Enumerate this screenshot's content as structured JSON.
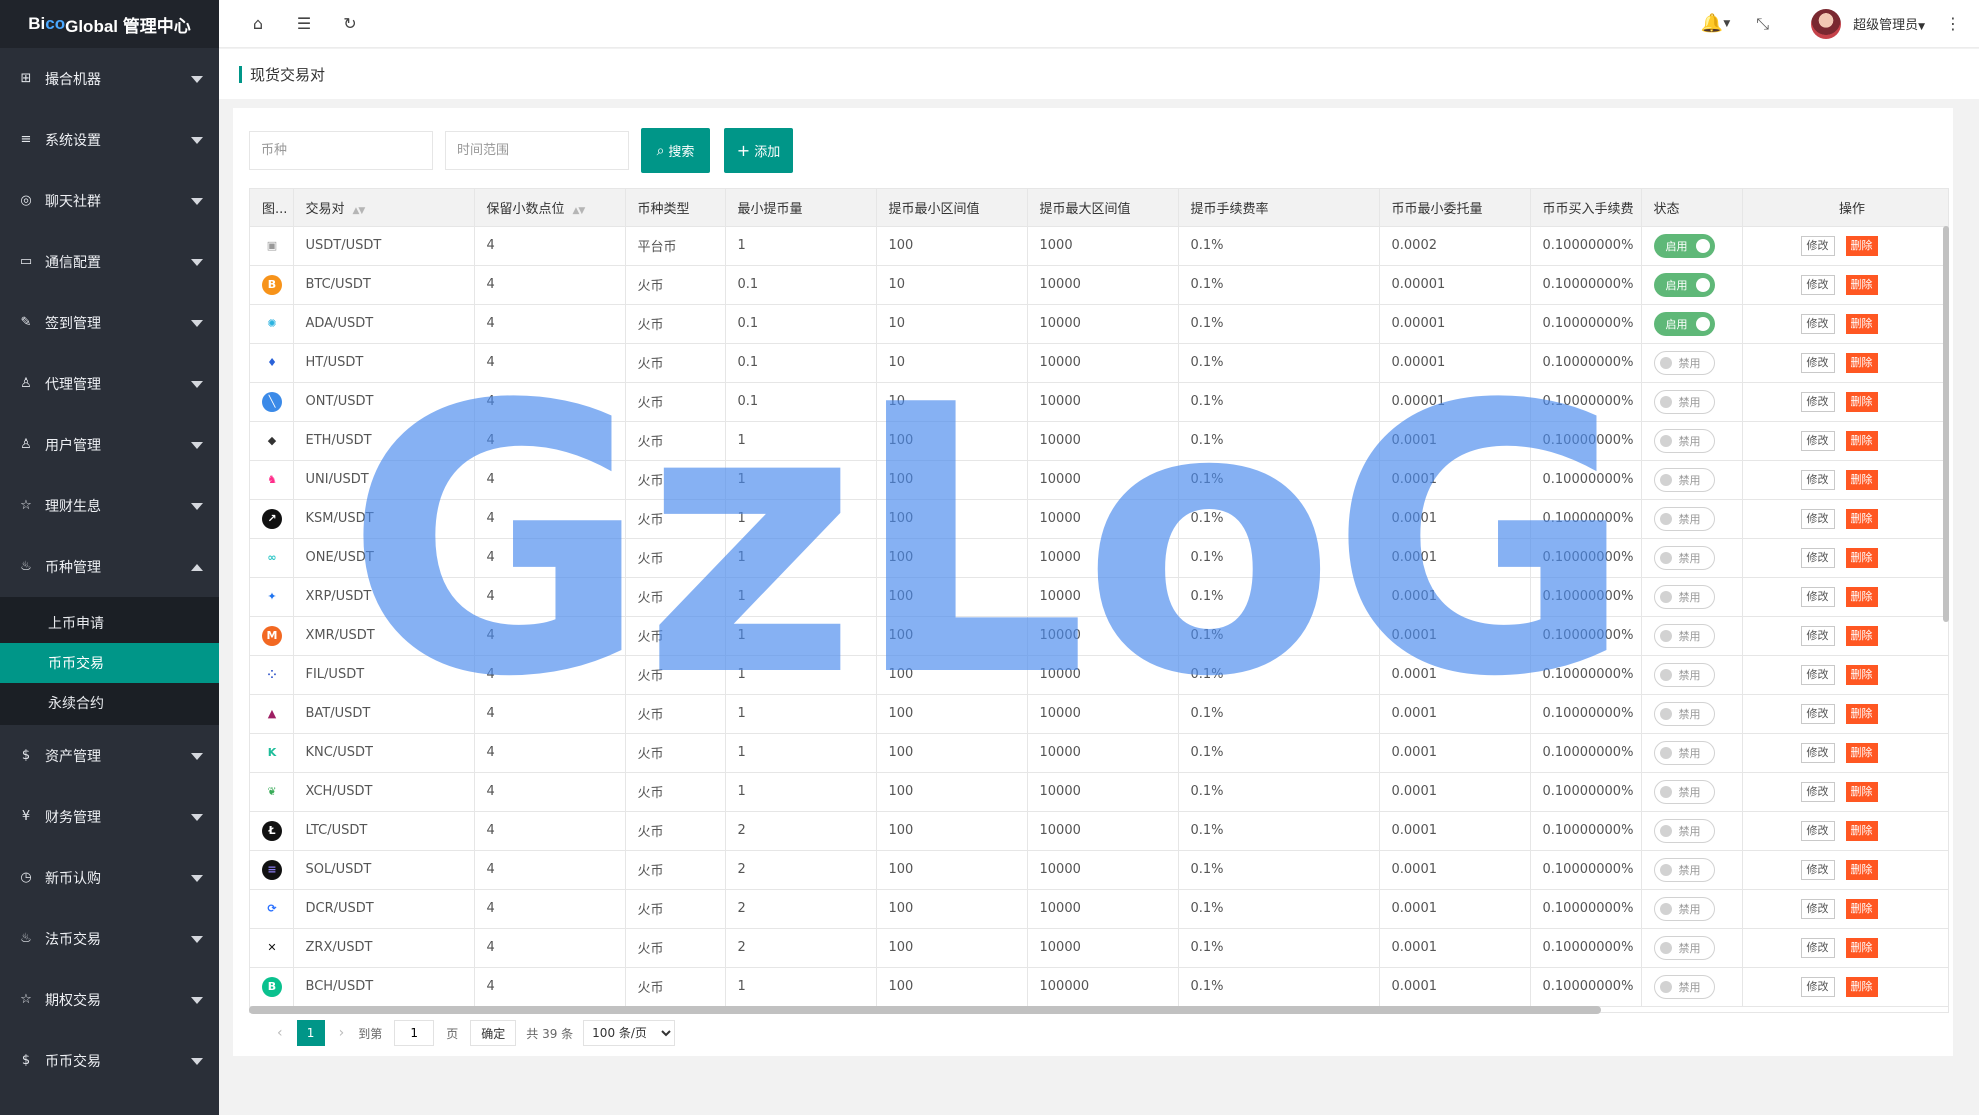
{
  "app": {
    "logo_part1": "Bi",
    "logo_accent": "co",
    "logo_part2": " Global 管理中心"
  },
  "sidebar": {
    "items_top": [
      {
        "label": "撮合机器",
        "icon": "grid-icon",
        "glyph": "⊞"
      },
      {
        "label": "系统设置",
        "icon": "sliders-icon",
        "glyph": "≡"
      },
      {
        "label": "聊天社群",
        "icon": "chat-icon",
        "glyph": "◎"
      },
      {
        "label": "通信配置",
        "icon": "device-icon",
        "glyph": "▭"
      },
      {
        "label": "签到管理",
        "icon": "edit-icon",
        "glyph": "✎"
      },
      {
        "label": "代理管理",
        "icon": "user-icon",
        "glyph": "♙"
      },
      {
        "label": "用户管理",
        "icon": "users-icon",
        "glyph": "♙"
      },
      {
        "label": "理财生息",
        "icon": "star-icon",
        "glyph": "☆"
      },
      {
        "label": "币种管理",
        "icon": "fire-icon",
        "glyph": "♨"
      }
    ],
    "submenu": [
      "上币申请",
      "币币交易",
      "永续合约"
    ],
    "items_bottom": [
      {
        "label": "资产管理",
        "icon": "dollar-icon",
        "glyph": "$"
      },
      {
        "label": "财务管理",
        "icon": "yen-icon",
        "glyph": "¥"
      },
      {
        "label": "新币认购",
        "icon": "clock-icon",
        "glyph": "◷"
      },
      {
        "label": "法币交易",
        "icon": "fire-icon",
        "glyph": "♨"
      },
      {
        "label": "期权交易",
        "icon": "star-icon",
        "glyph": "☆"
      },
      {
        "label": "币币交易",
        "icon": "dollar-icon",
        "glyph": "$"
      }
    ]
  },
  "header": {
    "user_name": "超级管理员"
  },
  "page": {
    "title": "现货交易对"
  },
  "search": {
    "coin_placeholder": "币种",
    "time_placeholder": "时间范围",
    "search_label": "搜索",
    "add_label": "添加"
  },
  "table": {
    "headers": [
      "图...",
      "交易对",
      "保留小数点位",
      "币种类型",
      "最小提币量",
      "提币最小区间值",
      "提币最大区间值",
      "提币手续费率",
      "币币最小委托量",
      "币币买入手续费",
      "状态",
      "操作"
    ],
    "edit_label": "修改",
    "delete_label": "删除",
    "on_label": "启用",
    "off_label": "禁用",
    "rows": [
      {
        "pair": "USDT/USDT",
        "decimals": "4",
        "type": "平台币",
        "min_w": "1",
        "w_min": "100",
        "w_max": "1000",
        "fee": "0.1%",
        "min_order": "0.0002",
        "buy_fee": "0.10000000%",
        "enabled": true,
        "icon_bg": "#ffffff",
        "icon_fg": "#999999",
        "glyph": "▣"
      },
      {
        "pair": "BTC/USDT",
        "decimals": "4",
        "type": "火币",
        "min_w": "0.1",
        "w_min": "10",
        "w_max": "10000",
        "fee": "0.1%",
        "min_order": "0.00001",
        "buy_fee": "0.10000000%",
        "enabled": true,
        "icon_bg": "#f7931a",
        "icon_fg": "#ffffff",
        "glyph": "B"
      },
      {
        "pair": "ADA/USDT",
        "decimals": "4",
        "type": "火币",
        "min_w": "0.1",
        "w_min": "10",
        "w_max": "10000",
        "fee": "0.1%",
        "min_order": "0.00001",
        "buy_fee": "0.10000000%",
        "enabled": true,
        "icon_bg": "#ffffff",
        "icon_fg": "#2bb3e0",
        "glyph": "✺"
      },
      {
        "pair": "HT/USDT",
        "decimals": "4",
        "type": "火币",
        "min_w": "0.1",
        "w_min": "10",
        "w_max": "10000",
        "fee": "0.1%",
        "min_order": "0.00001",
        "buy_fee": "0.10000000%",
        "enabled": false,
        "icon_bg": "#ffffff",
        "icon_fg": "#2a62d8",
        "glyph": "♦"
      },
      {
        "pair": "ONT/USDT",
        "decimals": "4",
        "type": "火币",
        "min_w": "0.1",
        "w_min": "10",
        "w_max": "10000",
        "fee": "0.1%",
        "min_order": "0.00001",
        "buy_fee": "0.10000000%",
        "enabled": false,
        "icon_bg": "#3b8ae8",
        "icon_fg": "#ffffff",
        "glyph": "╲"
      },
      {
        "pair": "ETH/USDT",
        "decimals": "4",
        "type": "火币",
        "min_w": "1",
        "w_min": "100",
        "w_max": "10000",
        "fee": "0.1%",
        "min_order": "0.0001",
        "buy_fee": "0.10000000%",
        "enabled": false,
        "icon_bg": "#ffffff",
        "icon_fg": "#333333",
        "glyph": "◆"
      },
      {
        "pair": "UNI/USDT",
        "decimals": "4",
        "type": "火币",
        "min_w": "1",
        "w_min": "100",
        "w_max": "10000",
        "fee": "0.1%",
        "min_order": "0.0001",
        "buy_fee": "0.10000000%",
        "enabled": false,
        "icon_bg": "#ffffff",
        "icon_fg": "#ff2d8a",
        "glyph": "♞"
      },
      {
        "pair": "KSM/USDT",
        "decimals": "4",
        "type": "火币",
        "min_w": "1",
        "w_min": "100",
        "w_max": "10000",
        "fee": "0.1%",
        "min_order": "0.0001",
        "buy_fee": "0.10000000%",
        "enabled": false,
        "icon_bg": "#111111",
        "icon_fg": "#ffffff",
        "glyph": "↗"
      },
      {
        "pair": "ONE/USDT",
        "decimals": "4",
        "type": "火币",
        "min_w": "1",
        "w_min": "100",
        "w_max": "10000",
        "fee": "0.1%",
        "min_order": "0.0001",
        "buy_fee": "0.10000000%",
        "enabled": false,
        "icon_bg": "#ffffff",
        "icon_fg": "#2bc6c6",
        "glyph": "∞"
      },
      {
        "pair": "XRP/USDT",
        "decimals": "4",
        "type": "火币",
        "min_w": "1",
        "w_min": "100",
        "w_max": "10000",
        "fee": "0.1%",
        "min_order": "0.0001",
        "buy_fee": "0.10000000%",
        "enabled": false,
        "icon_bg": "#ffffff",
        "icon_fg": "#1e73f0",
        "glyph": "✦"
      },
      {
        "pair": "XMR/USDT",
        "decimals": "4",
        "type": "火币",
        "min_w": "1",
        "w_min": "100",
        "w_max": "10000",
        "fee": "0.1%",
        "min_order": "0.0001",
        "buy_fee": "0.10000000%",
        "enabled": false,
        "icon_bg": "#f26822",
        "icon_fg": "#ffffff",
        "glyph": "M"
      },
      {
        "pair": "FIL/USDT",
        "decimals": "4",
        "type": "火币",
        "min_w": "1",
        "w_min": "100",
        "w_max": "10000",
        "fee": "0.1%",
        "min_order": "0.0001",
        "buy_fee": "0.10000000%",
        "enabled": false,
        "icon_bg": "#ffffff",
        "icon_fg": "#2b50c8",
        "glyph": "⁘"
      },
      {
        "pair": "BAT/USDT",
        "decimals": "4",
        "type": "火币",
        "min_w": "1",
        "w_min": "100",
        "w_max": "10000",
        "fee": "0.1%",
        "min_order": "0.0001",
        "buy_fee": "0.10000000%",
        "enabled": false,
        "icon_bg": "#ffffff",
        "icon_fg": "#9e1f63",
        "glyph": "▲"
      },
      {
        "pair": "KNC/USDT",
        "decimals": "4",
        "type": "火币",
        "min_w": "1",
        "w_min": "100",
        "w_max": "10000",
        "fee": "0.1%",
        "min_order": "0.0001",
        "buy_fee": "0.10000000%",
        "enabled": false,
        "icon_bg": "#ffffff",
        "icon_fg": "#1ebd9a",
        "glyph": "K"
      },
      {
        "pair": "XCH/USDT",
        "decimals": "4",
        "type": "火币",
        "min_w": "1",
        "w_min": "100",
        "w_max": "10000",
        "fee": "0.1%",
        "min_order": "0.0001",
        "buy_fee": "0.10000000%",
        "enabled": false,
        "icon_bg": "#ffffff",
        "icon_fg": "#3aac59",
        "glyph": "❦"
      },
      {
        "pair": "LTC/USDT",
        "decimals": "4",
        "type": "火币",
        "min_w": "2",
        "w_min": "100",
        "w_max": "10000",
        "fee": "0.1%",
        "min_order": "0.0001",
        "buy_fee": "0.10000000%",
        "enabled": false,
        "icon_bg": "#111111",
        "icon_fg": "#ffffff",
        "glyph": "Ł"
      },
      {
        "pair": "SOL/USDT",
        "decimals": "4",
        "type": "火币",
        "min_w": "2",
        "w_min": "100",
        "w_max": "10000",
        "fee": "0.1%",
        "min_order": "0.0001",
        "buy_fee": "0.10000000%",
        "enabled": false,
        "icon_bg": "#111111",
        "icon_fg": "#8a7cf0",
        "glyph": "≡"
      },
      {
        "pair": "DCR/USDT",
        "decimals": "4",
        "type": "火币",
        "min_w": "2",
        "w_min": "100",
        "w_max": "10000",
        "fee": "0.1%",
        "min_order": "0.0001",
        "buy_fee": "0.10000000%",
        "enabled": false,
        "icon_bg": "#ffffff",
        "icon_fg": "#2970ff",
        "glyph": "⟳"
      },
      {
        "pair": "ZRX/USDT",
        "decimals": "4",
        "type": "火币",
        "min_w": "2",
        "w_min": "100",
        "w_max": "10000",
        "fee": "0.1%",
        "min_order": "0.0001",
        "buy_fee": "0.10000000%",
        "enabled": false,
        "icon_bg": "#ffffff",
        "icon_fg": "#111111",
        "glyph": "✕"
      },
      {
        "pair": "BCH/USDT",
        "decimals": "4",
        "type": "火币",
        "min_w": "1",
        "w_min": "100",
        "w_max": "100000",
        "fee": "0.1%",
        "min_order": "0.0001",
        "buy_fee": "0.10000000%",
        "enabled": false,
        "icon_bg": "#0ac18e",
        "icon_fg": "#ffffff",
        "glyph": "B"
      }
    ]
  },
  "pager": {
    "current_page": "1",
    "goto_label": "到第",
    "page_input": "1",
    "page_unit": "页",
    "confirm_label": "确定",
    "total_label": "共 39 条",
    "page_size_options": [
      "100 条/页"
    ]
  },
  "watermark": {
    "text": "GzLoG"
  }
}
